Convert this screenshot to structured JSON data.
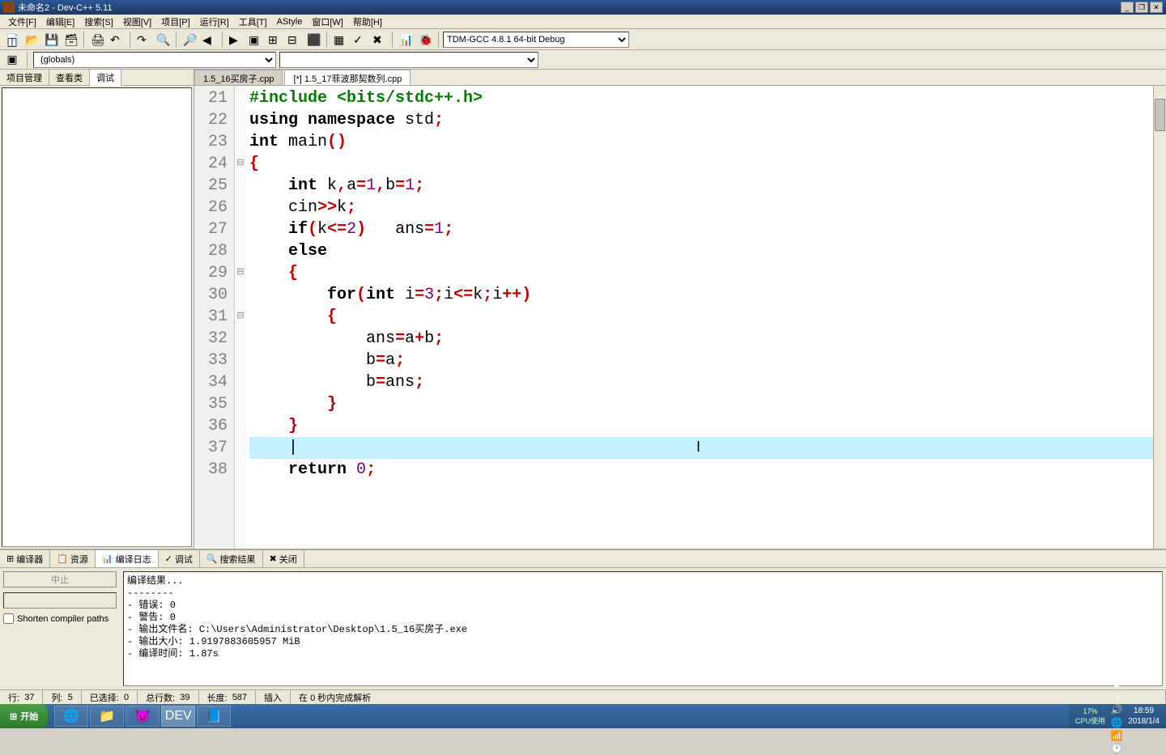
{
  "window": {
    "title": "未命名2 - Dev-C++ 5.11",
    "min": "_",
    "max": "❐",
    "close": "✕"
  },
  "menus": [
    "文件[F]",
    "编辑[E]",
    "搜索[S]",
    "视图[V]",
    "项目[P]",
    "运行[R]",
    "工具[T]",
    "AStyle",
    "窗口[W]",
    "帮助[H]"
  ],
  "compiler_profile": "TDM-GCC 4.8.1 64-bit Debug",
  "scope": "(globals)",
  "left_tabs": [
    "项目管理",
    "查看类",
    "调试"
  ],
  "left_active": 2,
  "editor_tabs": [
    "1.5_16买房子.cpp",
    "[*] 1.5_17菲波那契数列.cpp"
  ],
  "editor_active": 1,
  "gutter_start": 21,
  "code_lines": [
    {
      "tokens": [
        {
          "c": "pp",
          "t": "#include <bits/stdc++.h>"
        }
      ]
    },
    {
      "tokens": [
        {
          "c": "kw",
          "t": "using namespace"
        },
        {
          "c": "ident",
          "t": " std"
        },
        {
          "c": "op",
          "t": ";"
        }
      ]
    },
    {
      "tokens": [
        {
          "c": "kw",
          "t": "int"
        },
        {
          "c": "ident",
          "t": " main"
        },
        {
          "c": "op",
          "t": "()"
        }
      ]
    },
    {
      "fold": "⊟",
      "tokens": [
        {
          "c": "op",
          "t": "{"
        }
      ]
    },
    {
      "tokens": [
        {
          "c": "ident",
          "t": "    "
        },
        {
          "c": "kw",
          "t": "int"
        },
        {
          "c": "ident",
          "t": " k"
        },
        {
          "c": "op",
          "t": ","
        },
        {
          "c": "ident",
          "t": "a"
        },
        {
          "c": "op",
          "t": "="
        },
        {
          "c": "num",
          "t": "1"
        },
        {
          "c": "op",
          "t": ","
        },
        {
          "c": "ident",
          "t": "b"
        },
        {
          "c": "op",
          "t": "="
        },
        {
          "c": "num",
          "t": "1"
        },
        {
          "c": "op",
          "t": ";"
        }
      ]
    },
    {
      "tokens": [
        {
          "c": "ident",
          "t": "    cin"
        },
        {
          "c": "op",
          "t": ">>"
        },
        {
          "c": "ident",
          "t": "k"
        },
        {
          "c": "op",
          "t": ";"
        }
      ]
    },
    {
      "tokens": [
        {
          "c": "ident",
          "t": "    "
        },
        {
          "c": "kw",
          "t": "if"
        },
        {
          "c": "op",
          "t": "("
        },
        {
          "c": "ident",
          "t": "k"
        },
        {
          "c": "op",
          "t": "<="
        },
        {
          "c": "num",
          "t": "2"
        },
        {
          "c": "op",
          "t": ")"
        },
        {
          "c": "ident",
          "t": "   ans"
        },
        {
          "c": "op",
          "t": "="
        },
        {
          "c": "num",
          "t": "1"
        },
        {
          "c": "op",
          "t": ";"
        }
      ]
    },
    {
      "tokens": [
        {
          "c": "ident",
          "t": "    "
        },
        {
          "c": "kw",
          "t": "else"
        }
      ]
    },
    {
      "fold": "⊟",
      "tokens": [
        {
          "c": "ident",
          "t": "    "
        },
        {
          "c": "op",
          "t": "{"
        }
      ]
    },
    {
      "tokens": [
        {
          "c": "ident",
          "t": "        "
        },
        {
          "c": "kw",
          "t": "for"
        },
        {
          "c": "op",
          "t": "("
        },
        {
          "c": "kw",
          "t": "int"
        },
        {
          "c": "ident",
          "t": " i"
        },
        {
          "c": "op",
          "t": "="
        },
        {
          "c": "num",
          "t": "3"
        },
        {
          "c": "op",
          "t": ";"
        },
        {
          "c": "ident",
          "t": "i"
        },
        {
          "c": "op",
          "t": "<="
        },
        {
          "c": "ident",
          "t": "k"
        },
        {
          "c": "op",
          "t": ";"
        },
        {
          "c": "ident",
          "t": "i"
        },
        {
          "c": "op",
          "t": "++)"
        }
      ]
    },
    {
      "fold": "⊟",
      "tokens": [
        {
          "c": "ident",
          "t": "        "
        },
        {
          "c": "op",
          "t": "{"
        }
      ]
    },
    {
      "tokens": [
        {
          "c": "ident",
          "t": "            ans"
        },
        {
          "c": "op",
          "t": "="
        },
        {
          "c": "ident",
          "t": "a"
        },
        {
          "c": "op",
          "t": "+"
        },
        {
          "c": "ident",
          "t": "b"
        },
        {
          "c": "op",
          "t": ";"
        }
      ]
    },
    {
      "tokens": [
        {
          "c": "ident",
          "t": "            b"
        },
        {
          "c": "op",
          "t": "="
        },
        {
          "c": "ident",
          "t": "a"
        },
        {
          "c": "op",
          "t": ";"
        }
      ]
    },
    {
      "tokens": [
        {
          "c": "ident",
          "t": "            b"
        },
        {
          "c": "op",
          "t": "="
        },
        {
          "c": "ident",
          "t": "ans"
        },
        {
          "c": "op",
          "t": ";"
        }
      ]
    },
    {
      "tokens": [
        {
          "c": "ident",
          "t": "        "
        },
        {
          "c": "op",
          "t": "}"
        }
      ]
    },
    {
      "tokens": [
        {
          "c": "ident",
          "t": "    "
        },
        {
          "c": "op",
          "t": "}"
        }
      ]
    },
    {
      "current": true,
      "tokens": [
        {
          "c": "ident",
          "t": "    "
        }
      ]
    },
    {
      "tokens": [
        {
          "c": "ident",
          "t": "    "
        },
        {
          "c": "kw",
          "t": "return"
        },
        {
          "c": "ident",
          "t": " "
        },
        {
          "c": "num",
          "t": "0"
        },
        {
          "c": "op",
          "t": ";"
        }
      ]
    }
  ],
  "bottom_tabs": [
    {
      "icon": "⊞",
      "label": "编译器"
    },
    {
      "icon": "📋",
      "label": "资源"
    },
    {
      "icon": "📊",
      "label": "编译日志"
    },
    {
      "icon": "✓",
      "label": "调试"
    },
    {
      "icon": "🔍",
      "label": "搜索结果"
    },
    {
      "icon": "✖",
      "label": "关闭"
    }
  ],
  "bottom_active": 2,
  "abort_label": "中止",
  "shorten_label": "Shorten compiler paths",
  "compile_output": "编译结果...\n--------\n- 错误: 0\n- 警告: 0\n- 输出文件名: C:\\Users\\Administrator\\Desktop\\1.5_16买房子.exe\n- 输出大小: 1.9197883605957 MiB\n- 编译时间: 1.87s",
  "status": {
    "line_lbl": "行:",
    "line": "37",
    "col_lbl": "列:",
    "col": "5",
    "sel_lbl": "已选择:",
    "sel": "0",
    "total_lbl": "总行数:",
    "total": "39",
    "len_lbl": "长度:",
    "len": "587",
    "ins": "插入",
    "parse": "在 0 秒内完成解析"
  },
  "toolbar_icons": [
    "📄",
    "📂",
    "💾",
    "🗃",
    "🖨",
    "↶",
    "↷",
    "🔍",
    "🔎",
    "◀",
    "▶",
    "▣",
    "⊞",
    "⊟",
    "⬛",
    "▦",
    "✓",
    "✖",
    "📊",
    "🐞"
  ],
  "toolbar2_icons": [
    "◫",
    "▣",
    "▥"
  ],
  "start_label": "开始",
  "taskbar_apps": [
    "🌐",
    "📁",
    "😈",
    "DEV",
    "📘"
  ],
  "cpu": {
    "pct": "17%",
    "lbl": "CPU使用"
  },
  "tray_icons": [
    "▲",
    "♪",
    "🔊",
    "🌐",
    "📶",
    "🕐"
  ],
  "clock": {
    "time": "18:59",
    "date": "2018/1/4"
  }
}
